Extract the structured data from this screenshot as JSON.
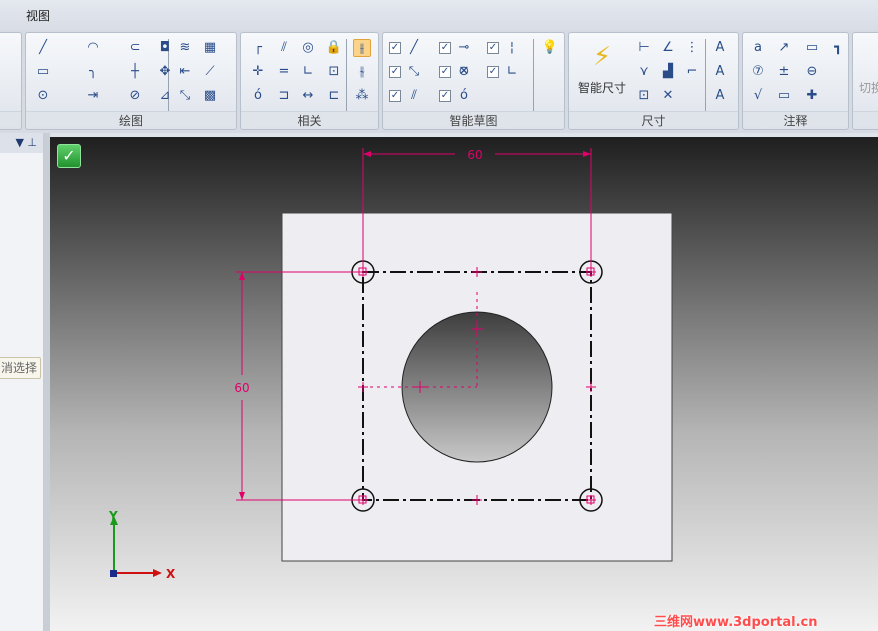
{
  "menu": {
    "view": "视图"
  },
  "ribbon": {
    "groups": [
      {
        "label": "绘图",
        "icons": [
          "line-icon",
          "arc-icon",
          "curve-offset-icon",
          "fill-region-icon",
          "rectangle-icon",
          "fillet-icon",
          "trim-icon",
          "move-icon",
          "circle-icon",
          "extend-icon",
          "split-icon",
          "mirror-icon",
          "wrap-icon",
          "distance-icon",
          "include-icon",
          "table-edit-icon",
          "offset-curve-icon",
          "fill-pattern-icon"
        ]
      },
      {
        "label": "相关",
        "icons": [
          "perpendicular-icon",
          "parallel-icon",
          "concentric-icon",
          "lock-icon",
          "connect-icon",
          "equal-icon",
          "right-angle-icon",
          "rigid-set-icon",
          "tangent-icon",
          "symmetric-icon",
          "horizontal-vertical-icon",
          "symmetry-axis-icon",
          "relation-handle-icon",
          "maintain-relations-icon",
          "relation-assistant-icon"
        ]
      },
      {
        "label": "智能草图",
        "icons": [
          "endpoint-icon",
          "midpoint-icon",
          "intersection-icon",
          "center-icon",
          "cross-icon",
          "perpendicular-point-icon",
          "vertical-icon",
          "tangent-point-icon",
          "parallel-point-icon",
          "smartsketch-options-icon"
        ]
      },
      {
        "label": "尺寸",
        "smart_dim": "智能尺寸",
        "icons": [
          "distance-between-icon",
          "angle-between-icon",
          "coordinate-dim-icon",
          "symmetric-diameter-icon",
          "chamfer-dim-icon",
          "angular-coordinate-icon",
          "coordinate-set-icon",
          "dim-axis-icon",
          "dim-style-icon",
          "text-larger-icon",
          "text-smaller-icon"
        ]
      },
      {
        "label": "注释",
        "icons": [
          "callout-icon",
          "leader-icon",
          "feature-control-frame-icon",
          "connector-icon",
          "balloon-icon",
          "datum-frame-icon",
          "datum-target-icon",
          "surface-texture-icon",
          "edge-condition-icon",
          "weld-icon"
        ]
      },
      {
        "label": "切换",
        "partial": "切换"
      }
    ]
  },
  "left_panel": {
    "cancel_selection": "消选择",
    "dropdown": "▼",
    "pin": "ᵖ"
  },
  "canvas": {
    "dim_horizontal": "60",
    "dim_vertical": "60",
    "axis_x": "X",
    "axis_y": "Y",
    "dimension_color": "#e0006a",
    "sketch_color": "#111111"
  },
  "watermark": "三维网www.3dportal.cn"
}
